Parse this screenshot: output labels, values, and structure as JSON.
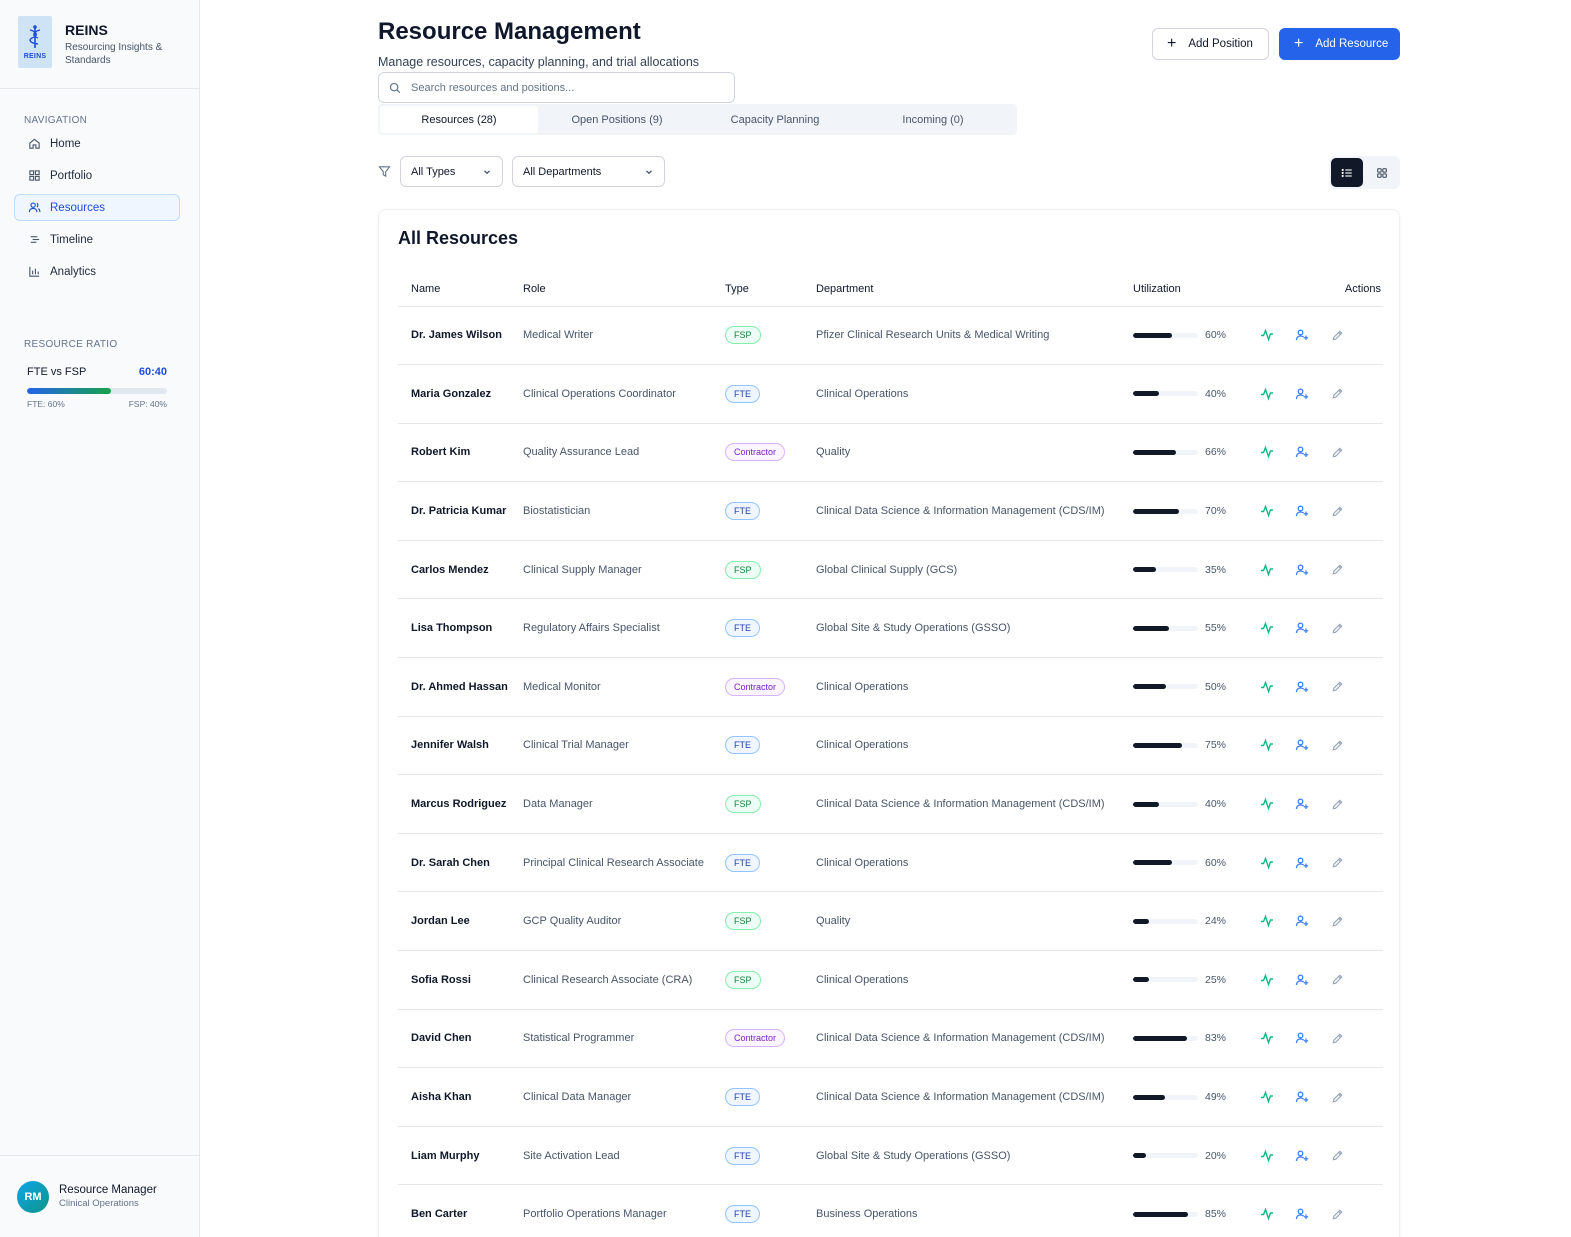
{
  "brand": {
    "name": "REINS",
    "subtitle": "Resourcing Insights & Standards",
    "logo_text": "REINS"
  },
  "sidebar": {
    "nav_heading": "NAVIGATION",
    "items": [
      {
        "label": "Home",
        "icon": "home-icon"
      },
      {
        "label": "Portfolio",
        "icon": "grid-icon"
      },
      {
        "label": "Resources",
        "icon": "users-icon",
        "active": true
      },
      {
        "label": "Timeline",
        "icon": "timeline-icon"
      },
      {
        "label": "Analytics",
        "icon": "bar-chart-icon"
      }
    ],
    "ratio": {
      "heading": "RESOURCE RATIO",
      "label": "FTE vs FSP",
      "value": "60:40",
      "fte_fraction": 0.6,
      "fte_label": "FTE: 60%",
      "fsp_label": "FSP: 40%"
    },
    "user": {
      "initials": "RM",
      "name": "Resource Manager",
      "role": "Clinical Operations"
    }
  },
  "header": {
    "title": "Resource Management",
    "subtitle": "Manage resources, capacity planning, and trial allocations",
    "add_position": "Add Position",
    "add_resource": "Add Resource"
  },
  "search": {
    "placeholder": "Search resources and positions..."
  },
  "tabs": [
    {
      "label": "Resources (28)",
      "active": true
    },
    {
      "label": "Open Positions (9)"
    },
    {
      "label": "Capacity Planning"
    },
    {
      "label": "Incoming (0)"
    }
  ],
  "filters": {
    "type": "All Types",
    "department": "All Departments"
  },
  "table": {
    "title": "All Resources",
    "columns": [
      "Name",
      "Role",
      "Type",
      "Department",
      "Utilization",
      "Actions"
    ],
    "rows": [
      {
        "name": "Dr. James Wilson",
        "role": "Medical Writer",
        "type": "FSP",
        "department": "Pfizer Clinical Research Units & Medical Writing",
        "utilization": 60,
        "util_label": "60%"
      },
      {
        "name": "Maria Gonzalez",
        "role": "Clinical Operations Coordinator",
        "type": "FTE",
        "department": "Clinical Operations",
        "utilization": 40,
        "util_label": "40%"
      },
      {
        "name": "Robert Kim",
        "role": "Quality Assurance Lead",
        "type": "Contractor",
        "department": "Quality",
        "utilization": 66,
        "util_label": "66%"
      },
      {
        "name": "Dr. Patricia Kumar",
        "role": "Biostatistician",
        "type": "FTE",
        "department": "Clinical Data Science & Information Management (CDS/IM)",
        "utilization": 70,
        "util_label": "70%"
      },
      {
        "name": "Carlos Mendez",
        "role": "Clinical Supply Manager",
        "type": "FSP",
        "department": "Global Clinical Supply (GCS)",
        "utilization": 35,
        "util_label": "35%"
      },
      {
        "name": "Lisa Thompson",
        "role": "Regulatory Affairs Specialist",
        "type": "FTE",
        "department": "Global Site & Study Operations (GSSO)",
        "utilization": 55,
        "util_label": "55%"
      },
      {
        "name": "Dr. Ahmed Hassan",
        "role": "Medical Monitor",
        "type": "Contractor",
        "department": "Clinical Operations",
        "utilization": 50,
        "util_label": "50%"
      },
      {
        "name": "Jennifer Walsh",
        "role": "Clinical Trial Manager",
        "type": "FTE",
        "department": "Clinical Operations",
        "utilization": 75,
        "util_label": "75%"
      },
      {
        "name": "Marcus Rodriguez",
        "role": "Data Manager",
        "type": "FSP",
        "department": "Clinical Data Science & Information Management (CDS/IM)",
        "utilization": 40,
        "util_label": "40%"
      },
      {
        "name": "Dr. Sarah Chen",
        "role": "Principal Clinical Research Associate",
        "type": "FTE",
        "department": "Clinical Operations",
        "utilization": 60,
        "util_label": "60%"
      },
      {
        "name": "Jordan Lee",
        "role": "GCP Quality Auditor",
        "type": "FSP",
        "department": "Quality",
        "utilization": 24,
        "util_label": "24%"
      },
      {
        "name": "Sofia Rossi",
        "role": "Clinical Research Associate (CRA)",
        "type": "FSP",
        "department": "Clinical Operations",
        "utilization": 25,
        "util_label": "25%"
      },
      {
        "name": "David Chen",
        "role": "Statistical Programmer",
        "type": "Contractor",
        "department": "Clinical Data Science & Information Management (CDS/IM)",
        "utilization": 83,
        "util_label": "83%"
      },
      {
        "name": "Aisha Khan",
        "role": "Clinical Data Manager",
        "type": "FTE",
        "department": "Clinical Data Science & Information Management (CDS/IM)",
        "utilization": 49,
        "util_label": "49%"
      },
      {
        "name": "Liam Murphy",
        "role": "Site Activation Lead",
        "type": "FTE",
        "department": "Global Site & Study Operations (GSSO)",
        "utilization": 20,
        "util_label": "20%"
      },
      {
        "name": "Ben Carter",
        "role": "Portfolio Operations Manager",
        "type": "FTE",
        "department": "Business Operations",
        "utilization": 85,
        "util_label": "85%"
      }
    ]
  },
  "badge_colors": {
    "FSP": {
      "bg": "#ecfdf5",
      "border": "#86efac",
      "text": "#15803d"
    },
    "FTE": {
      "bg": "#eff6ff",
      "border": "#93c5fd",
      "text": "#1e40af"
    },
    "Contractor": {
      "bg": "#faf5ff",
      "border": "#d8b4fe",
      "text": "#7e22ce"
    }
  },
  "colors": {
    "accent": "#2563eb",
    "activity": "#10b981",
    "assign": "#3b82f6",
    "edit": "#94a3b8"
  }
}
